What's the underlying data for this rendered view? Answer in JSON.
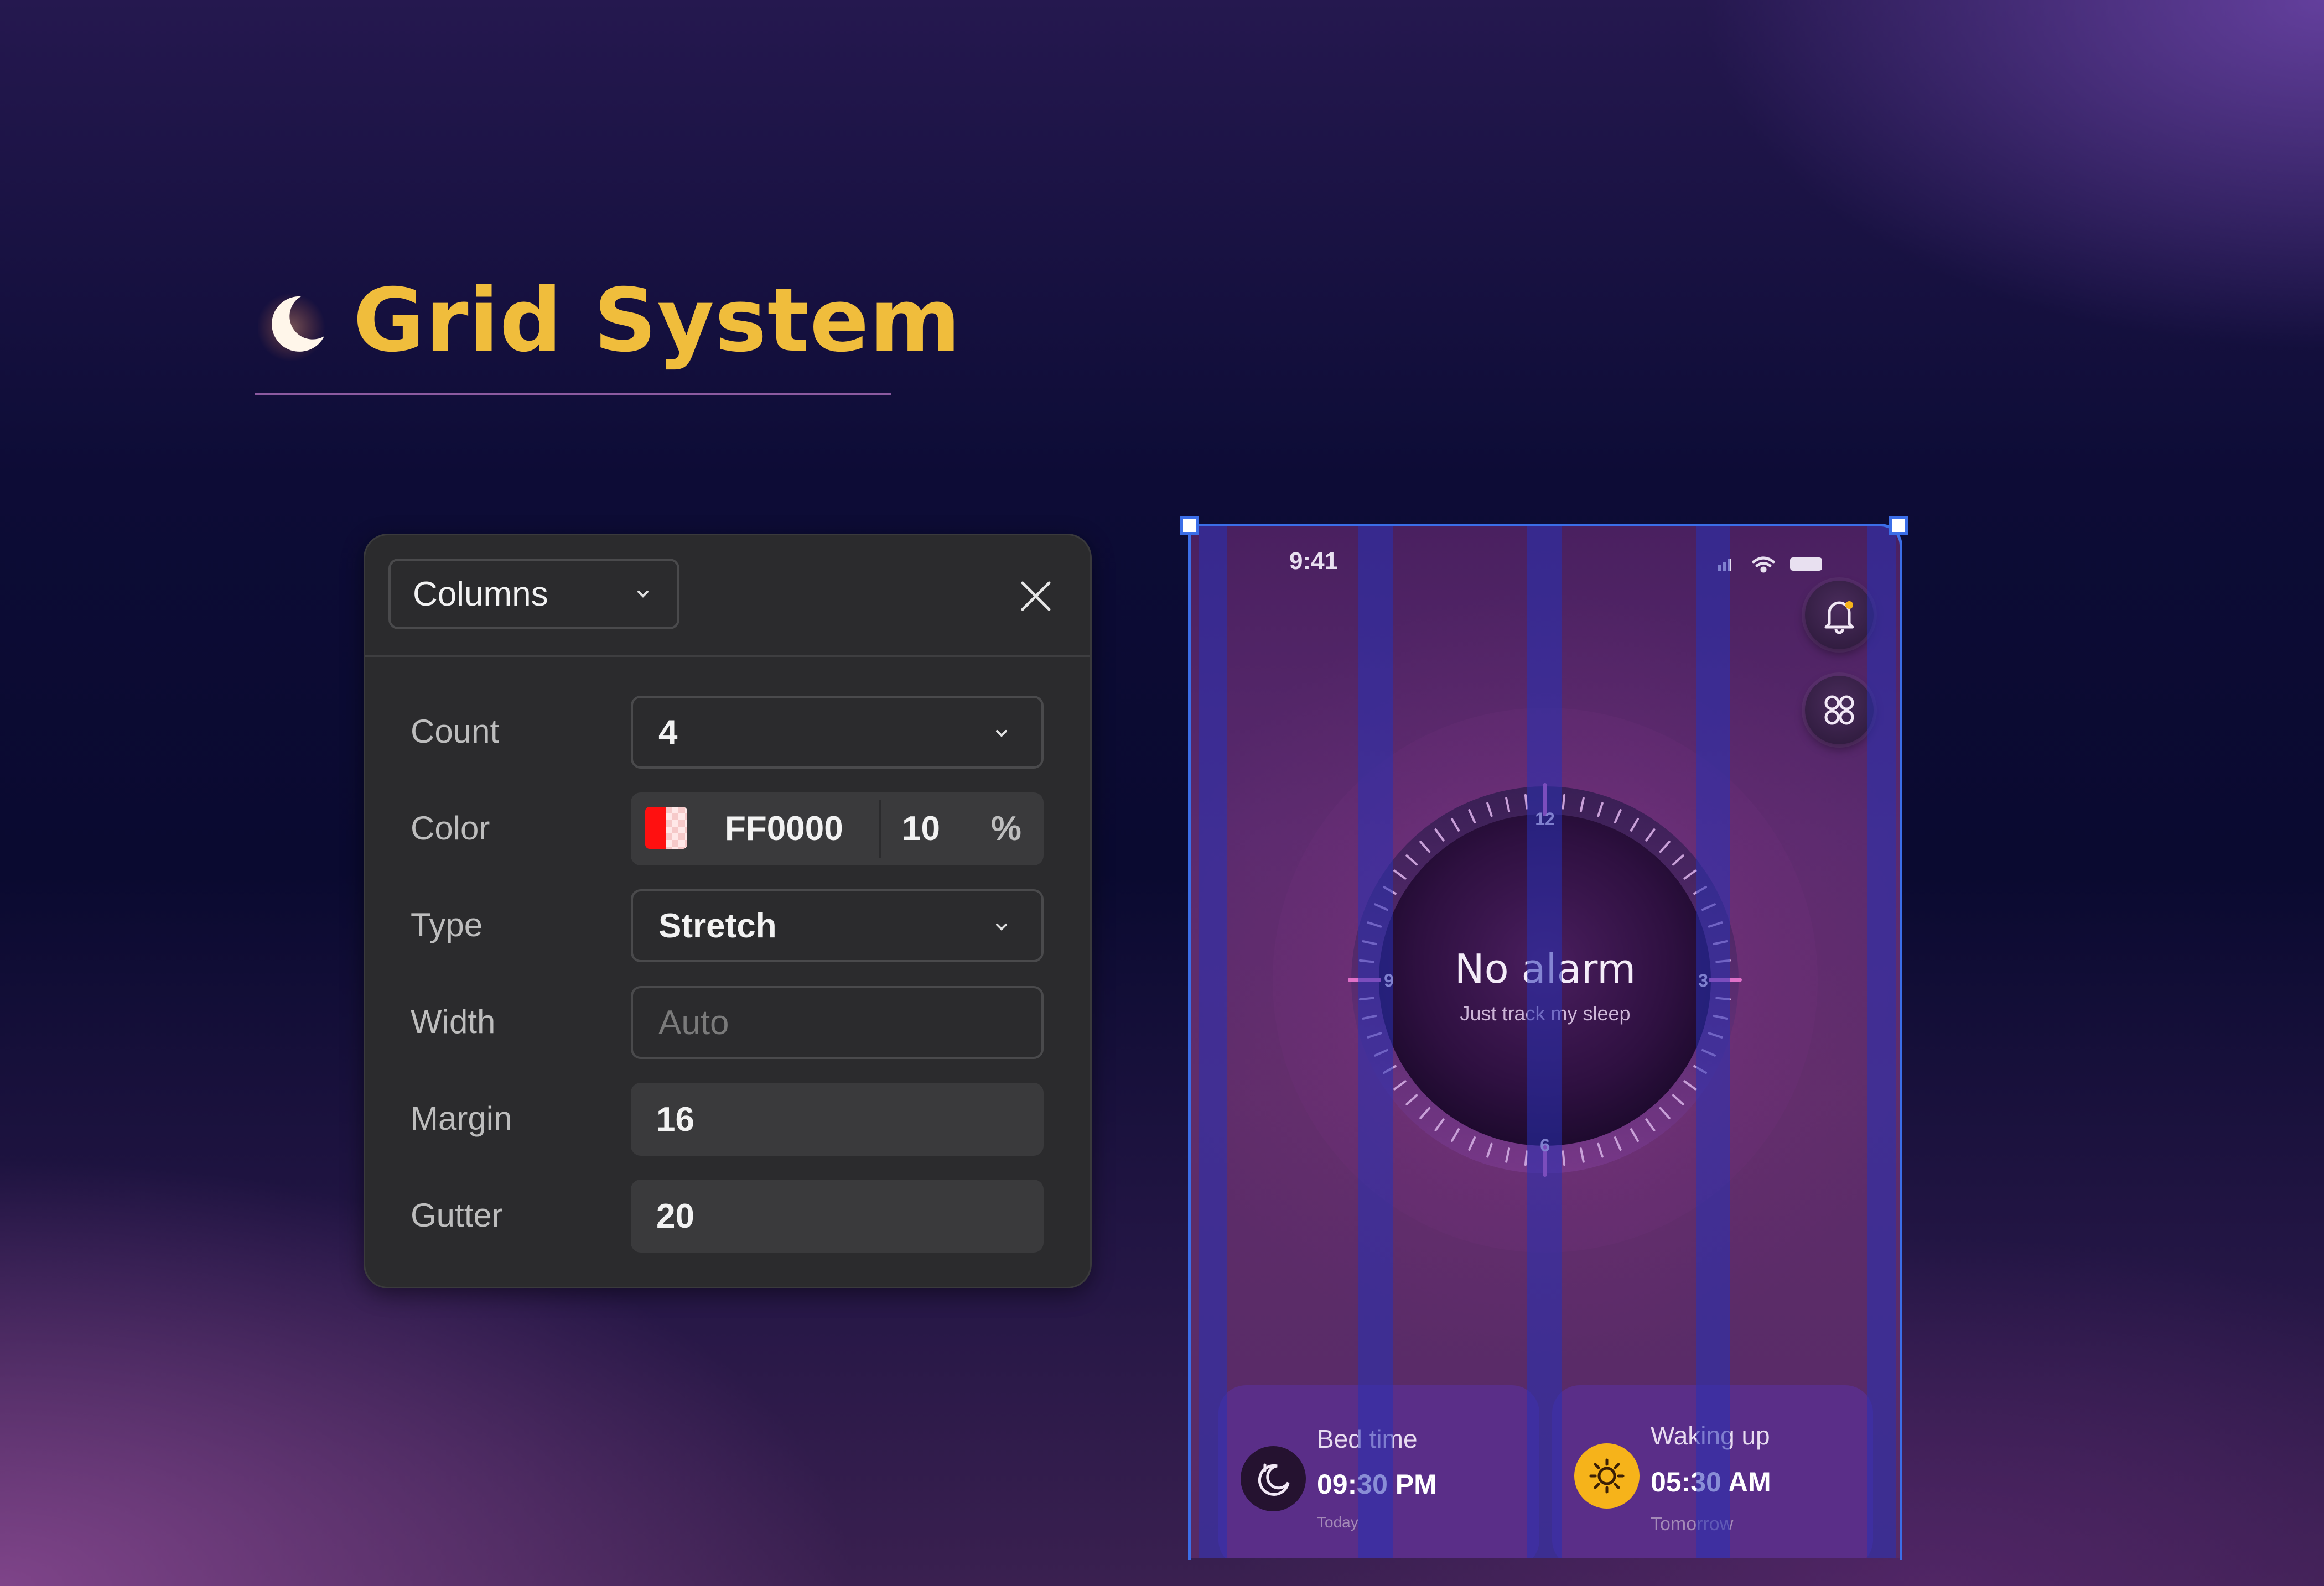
{
  "heading": {
    "title": "Grid System",
    "title_color": "#f0bd3c",
    "icon": "crescent-moon-icon"
  },
  "grid_panel": {
    "layout_select": "Columns",
    "fields": {
      "count": {
        "label": "Count",
        "value": "4"
      },
      "color": {
        "label": "Color",
        "hex": "FF0000",
        "opacity": "10",
        "unit": "%",
        "swatch": "#ff0000"
      },
      "type": {
        "label": "Type",
        "value": "Stretch"
      },
      "width": {
        "label": "Width",
        "placeholder": "Auto"
      },
      "margin": {
        "label": "Margin",
        "value": "16"
      },
      "gutter": {
        "label": "Gutter",
        "value": "20"
      }
    }
  },
  "phone": {
    "status_time": "9:41",
    "alarm": {
      "title": "No alarm",
      "subtitle": "Just track my sleep"
    },
    "clock_labels": {
      "top": "12",
      "right": "3",
      "bottom": "6",
      "left": "9"
    },
    "cards": {
      "bed": {
        "title": "Bed time",
        "time": "09:30 PM",
        "day": "Today",
        "icon": "moon-clock-icon"
      },
      "wake": {
        "title": "Waking up",
        "time": "05:30 AM",
        "day": "Tomorrow",
        "icon": "sun-icon"
      }
    },
    "grid_overlay_color": "#2832b4",
    "selection_color": "#3b6ee8"
  }
}
